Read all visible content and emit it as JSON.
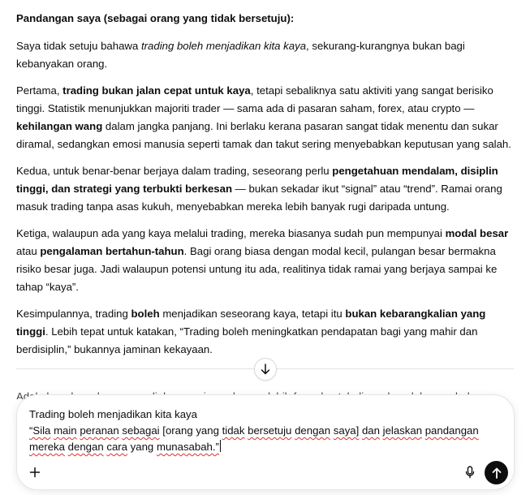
{
  "conversation": {
    "heading": "Pandangan saya (sebagai orang yang tidak bersetuju):",
    "p1": {
      "a": "Saya tidak setuju bahawa ",
      "b": "trading boleh menjadikan kita kaya",
      "c": ", sekurang-kurangnya bukan bagi kebanyakan orang."
    },
    "p2": {
      "a": "Pertama, ",
      "b": "trading bukan jalan cepat untuk kaya",
      "c": ", tetapi sebaliknya satu aktiviti yang sangat berisiko tinggi. Statistik menunjukkan majoriti trader — sama ada di pasaran saham, forex, atau crypto — ",
      "d": "kehilangan wang",
      "e": " dalam jangka panjang. Ini berlaku kerana pasaran sangat tidak menentu dan sukar diramal, sedangkan emosi manusia seperti tamak dan takut sering menyebabkan keputusan yang salah."
    },
    "p3": {
      "a": "Kedua, untuk benar-benar berjaya dalam trading, seseorang perlu ",
      "b": "pengetahuan mendalam, disiplin tinggi, dan strategi yang terbukti berkesan",
      "c": " — bukan sekadar ikut “signal” atau “trend”. Ramai orang masuk trading tanpa asas kukuh, menyebabkan mereka lebih banyak rugi daripada untung."
    },
    "p4": {
      "a": "Ketiga, walaupun ada yang kaya melalui trading, mereka biasanya sudah pun mempunyai ",
      "b": "modal besar",
      "c": " atau ",
      "d": "pengalaman bertahun-tahun",
      "e": ". Bagi orang biasa dengan modal kecil, pulangan besar bermakna risiko besar juga. Jadi walaupun potensi untung itu ada, realitinya tidak ramai yang berjaya sampai ke tahap “kaya”."
    },
    "p5": {
      "a": "Kesimpulannya, trading ",
      "b": "boleh",
      "c": " menjadikan seseorang kaya, tetapi itu ",
      "d": "bukan kebarangkalian yang tinggi",
      "e": ". Lebih tepat untuk katakan, “Trading boleh meningkatkan pendapatan bagi yang mahir dan berdisiplin,” bukannya jaminan kekayaan."
    },
    "peek_text": "Adakah anda mahu saya sediakan versi penuh yang lebih formal untuk digunakan dalam perbahasan atau pembentangan?"
  },
  "composer": {
    "line1": "Trading boleh menjadikan kita kaya",
    "w1": "“Sila",
    "w2": "main",
    "w3": "peranan",
    "w4": "sebagai",
    "w5": "[orang yang",
    "w6": "tidak",
    "w7": "bersetuju",
    "w8": "dengan",
    "w9": "saya]",
    "w10": "dan",
    "w11": "jelaskan",
    "w12": "pandangan",
    "w13": "mereka",
    "w14": "dengan",
    "w15": "cara",
    "w16": "yang",
    "w17": "munasabah.”"
  },
  "icons": {
    "scroll_down": "arrow-down-icon",
    "plus": "plus-icon",
    "mic": "microphone-icon",
    "send": "arrow-up-icon"
  },
  "colors": {
    "send_button": "#0d0d0d",
    "spellcheck_underline": "#e0302b",
    "text": "#0d0d0d"
  }
}
